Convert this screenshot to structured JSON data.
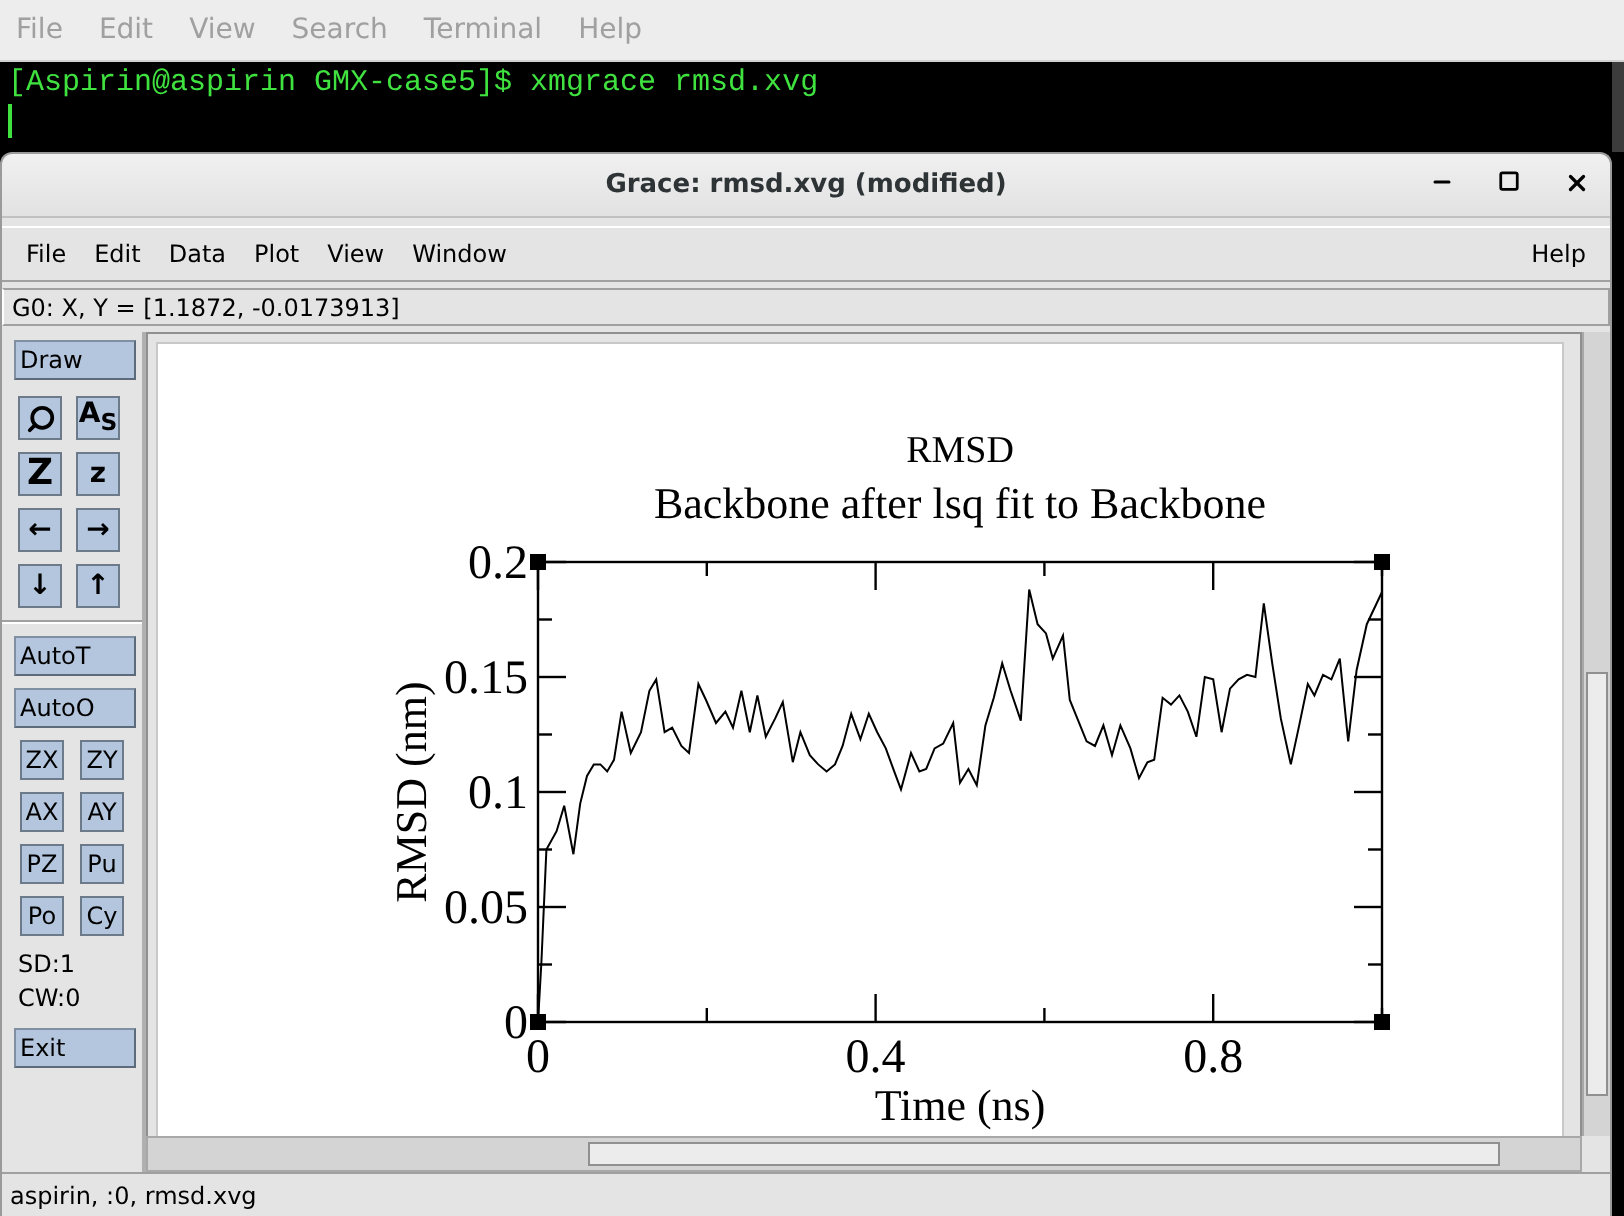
{
  "terminal": {
    "menu": [
      "File",
      "Edit",
      "View",
      "Search",
      "Terminal",
      "Help"
    ],
    "line": "[Aspirin@aspirin GMX-case5]$ xmgrace rmsd.xvg"
  },
  "window": {
    "title": "Grace: rmsd.xvg (modified)"
  },
  "menu": [
    "File",
    "Edit",
    "Data",
    "Plot",
    "View",
    "Window"
  ],
  "help": "Help",
  "locator": "G0: X, Y = [1.1872, -0.0173913]",
  "toolbar": {
    "draw": "Draw",
    "tools": [
      {
        "kind": "icon"
      },
      {
        "kind": "text",
        "label": "A$_{S}$"
      },
      {
        "kind": "text",
        "label": "Z"
      },
      {
        "kind": "text",
        "label": "z"
      },
      {
        "kind": "text",
        "label": "←"
      },
      {
        "kind": "text",
        "label": "→"
      },
      {
        "kind": "text",
        "label": "↓"
      },
      {
        "kind": "text",
        "label": "↑"
      }
    ],
    "auto": [
      "AutoT",
      "AutoO"
    ],
    "pairs": [
      "ZX",
      "ZY",
      "AX",
      "AY",
      "PZ",
      "Pu",
      "Po",
      "Cy"
    ],
    "info": [
      "SD:1",
      "CW:0"
    ],
    "exit": "Exit"
  },
  "canvas": {
    "subtitle": "Backbone after lsq fit to Backbone",
    "chart_data": {
      "type": "line",
      "title": "RMSD",
      "xlabel": "Time (ns)",
      "ylabel": "RMSD (nm)",
      "xlim": [
        0,
        1
      ],
      "ylim": [
        0,
        0.2
      ],
      "xticks": [
        0,
        0.4,
        0.8
      ],
      "yticks": [
        0,
        0.05,
        0.1,
        0.15,
        0.2
      ],
      "x": [
        0,
        0.004,
        0.01,
        0.022,
        0.031,
        0.042,
        0.05,
        0.058,
        0.066,
        0.074,
        0.082,
        0.09,
        0.099,
        0.11,
        0.122,
        0.132,
        0.14,
        0.15,
        0.159,
        0.17,
        0.179,
        0.19,
        0.199,
        0.211,
        0.222,
        0.231,
        0.241,
        0.251,
        0.26,
        0.27,
        0.281,
        0.29,
        0.302,
        0.311,
        0.322,
        0.332,
        0.342,
        0.352,
        0.361,
        0.371,
        0.382,
        0.392,
        0.402,
        0.412,
        0.422,
        0.43,
        0.442,
        0.452,
        0.46,
        0.47,
        0.48,
        0.492,
        0.5,
        0.51,
        0.52,
        0.53,
        0.54,
        0.55,
        0.56,
        0.572,
        0.582,
        0.592,
        0.602,
        0.61,
        0.622,
        0.63,
        0.64,
        0.65,
        0.66,
        0.67,
        0.68,
        0.69,
        0.702,
        0.712,
        0.722,
        0.73,
        0.74,
        0.75,
        0.76,
        0.77,
        0.78,
        0.79,
        0.8,
        0.81,
        0.82,
        0.83,
        0.84,
        0.85,
        0.86,
        0.87,
        0.88,
        0.892,
        0.902,
        0.912,
        0.92,
        0.93,
        0.94,
        0.95,
        0.96,
        0.97,
        0.982,
        1.0
      ],
      "series": [
        {
          "color": "#000000",
          "values": [
            0,
            0.026,
            0.075,
            0.083,
            0.094,
            0.073,
            0.095,
            0.107,
            0.112,
            0.112,
            0.109,
            0.114,
            0.135,
            0.117,
            0.126,
            0.144,
            0.149,
            0.126,
            0.128,
            0.12,
            0.117,
            0.147,
            0.14,
            0.13,
            0.135,
            0.128,
            0.144,
            0.126,
            0.142,
            0.124,
            0.132,
            0.139,
            0.113,
            0.126,
            0.116,
            0.112,
            0.109,
            0.112,
            0.12,
            0.134,
            0.123,
            0.134,
            0.126,
            0.119,
            0.109,
            0.101,
            0.117,
            0.109,
            0.11,
            0.119,
            0.121,
            0.13,
            0.104,
            0.11,
            0.103,
            0.129,
            0.141,
            0.156,
            0.144,
            0.131,
            0.188,
            0.173,
            0.169,
            0.158,
            0.168,
            0.14,
            0.131,
            0.122,
            0.12,
            0.129,
            0.116,
            0.129,
            0.119,
            0.106,
            0.113,
            0.114,
            0.141,
            0.138,
            0.142,
            0.135,
            0.124,
            0.15,
            0.149,
            0.126,
            0.145,
            0.149,
            0.151,
            0.15,
            0.182,
            0.156,
            0.132,
            0.112,
            0.129,
            0.147,
            0.142,
            0.151,
            0.149,
            0.158,
            0.122,
            0.153,
            0.173,
            0.187
          ]
        }
      ]
    }
  },
  "status": "aspirin, :0, rmsd.xvg"
}
